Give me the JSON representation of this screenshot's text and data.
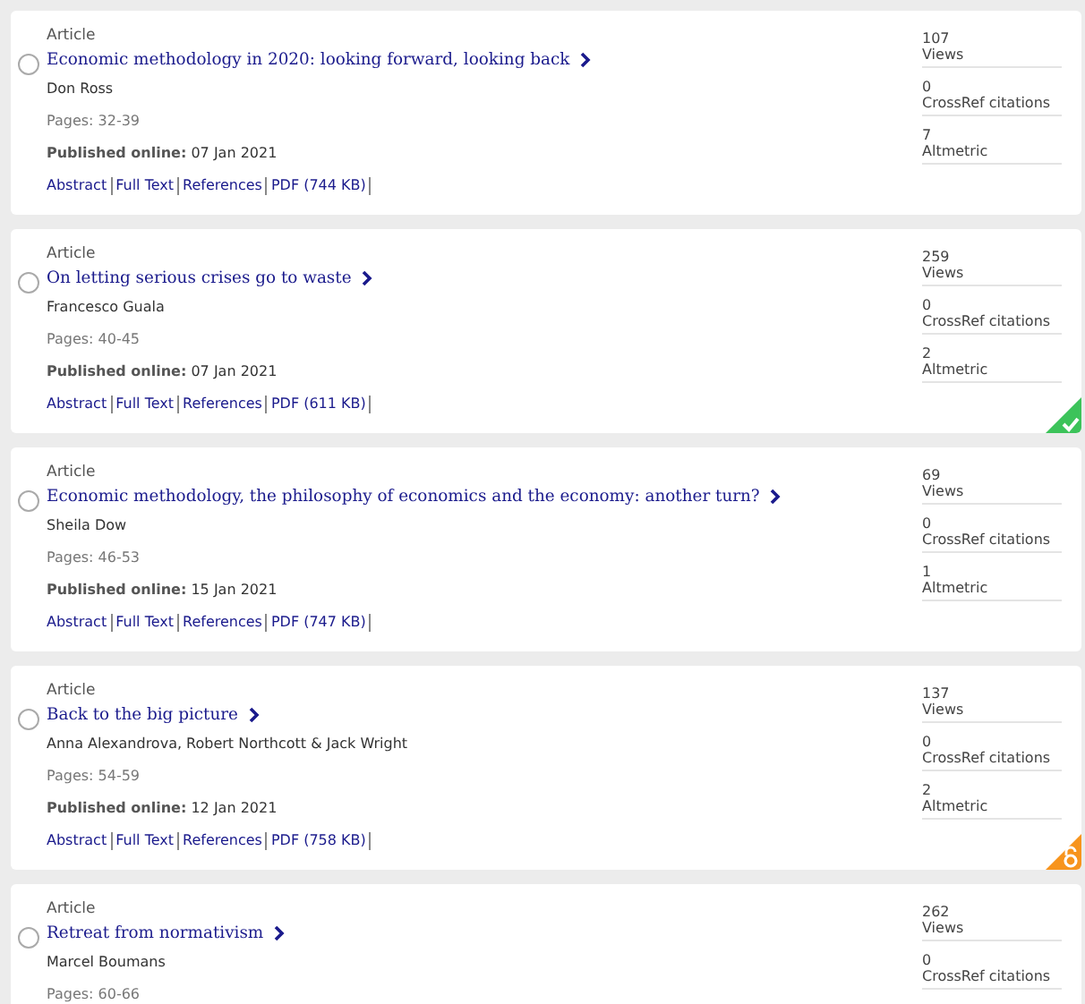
{
  "articles": [
    {
      "type": "Article",
      "title": "Economic methodology in 2020: looking forward, looking back",
      "authors": "Don Ross",
      "pages": "Pages: 32-39",
      "published_label": "Published online:",
      "published_date": "07 Jan 2021",
      "links": [
        "Abstract",
        "Full Text",
        "References",
        "PDF (744 KB)"
      ],
      "selected": false,
      "kind": "plain",
      "stats": [
        {
          "value": "107",
          "label": "Views"
        },
        {
          "value": "0",
          "label": "CrossRef citations"
        },
        {
          "value": "7",
          "label": "Altmetric"
        }
      ]
    },
    {
      "type": "Article",
      "title": "On letting serious crises go to waste",
      "authors": "Francesco Guala",
      "pages": "Pages: 40-45",
      "published_label": "Published online:",
      "published_date": "07 Jan 2021",
      "links": [
        "Abstract",
        "Full Text",
        "References",
        "PDF (611 KB)"
      ],
      "selected": false,
      "kind": "free",
      "stats": [
        {
          "value": "259",
          "label": "Views"
        },
        {
          "value": "0",
          "label": "CrossRef citations"
        },
        {
          "value": "2",
          "label": "Altmetric"
        }
      ]
    },
    {
      "type": "Article",
      "title": "Economic methodology, the philosophy of economics and the economy: another turn?",
      "authors": "Sheila Dow",
      "pages": "Pages: 46-53",
      "published_label": "Published online:",
      "published_date": "15 Jan 2021",
      "links": [
        "Abstract",
        "Full Text",
        "References",
        "PDF (747 KB)"
      ],
      "selected": false,
      "kind": "plain",
      "stats": [
        {
          "value": "69",
          "label": "Views"
        },
        {
          "value": "0",
          "label": "CrossRef citations"
        },
        {
          "value": "1",
          "label": "Altmetric"
        }
      ]
    },
    {
      "type": "Article",
      "title": "Back to the big picture",
      "authors": "Anna Alexandrova, Robert Northcott & Jack Wright",
      "pages": "Pages: 54-59",
      "published_label": "Published online:",
      "published_date": "12 Jan 2021",
      "links": [
        "Abstract",
        "Full Text",
        "References",
        "PDF (758 KB)"
      ],
      "selected": false,
      "kind": "open",
      "stats": [
        {
          "value": "137",
          "label": "Views"
        },
        {
          "value": "0",
          "label": "CrossRef citations"
        },
        {
          "value": "2",
          "label": "Altmetric"
        }
      ]
    },
    {
      "type": "Article",
      "title": "Retreat from normativism",
      "authors": "Marcel Boumans",
      "pages": "Pages: 60-66",
      "selected": false,
      "kind": "plain",
      "stats": [
        {
          "value": "262",
          "label": "Views"
        },
        {
          "value": "0",
          "label": "CrossRef citations"
        }
      ]
    }
  ]
}
